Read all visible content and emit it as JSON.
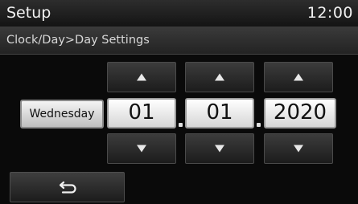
{
  "header": {
    "title": "Setup",
    "time": "12:00"
  },
  "breadcrumb": {
    "text": "Clock/Day>Day Settings"
  },
  "day": {
    "label": "Wednesday"
  },
  "date": {
    "month": "01",
    "day": "01",
    "year": "2020"
  },
  "icons": {
    "up": "up-arrow-icon",
    "down": "down-arrow-icon",
    "back": "back-icon"
  }
}
